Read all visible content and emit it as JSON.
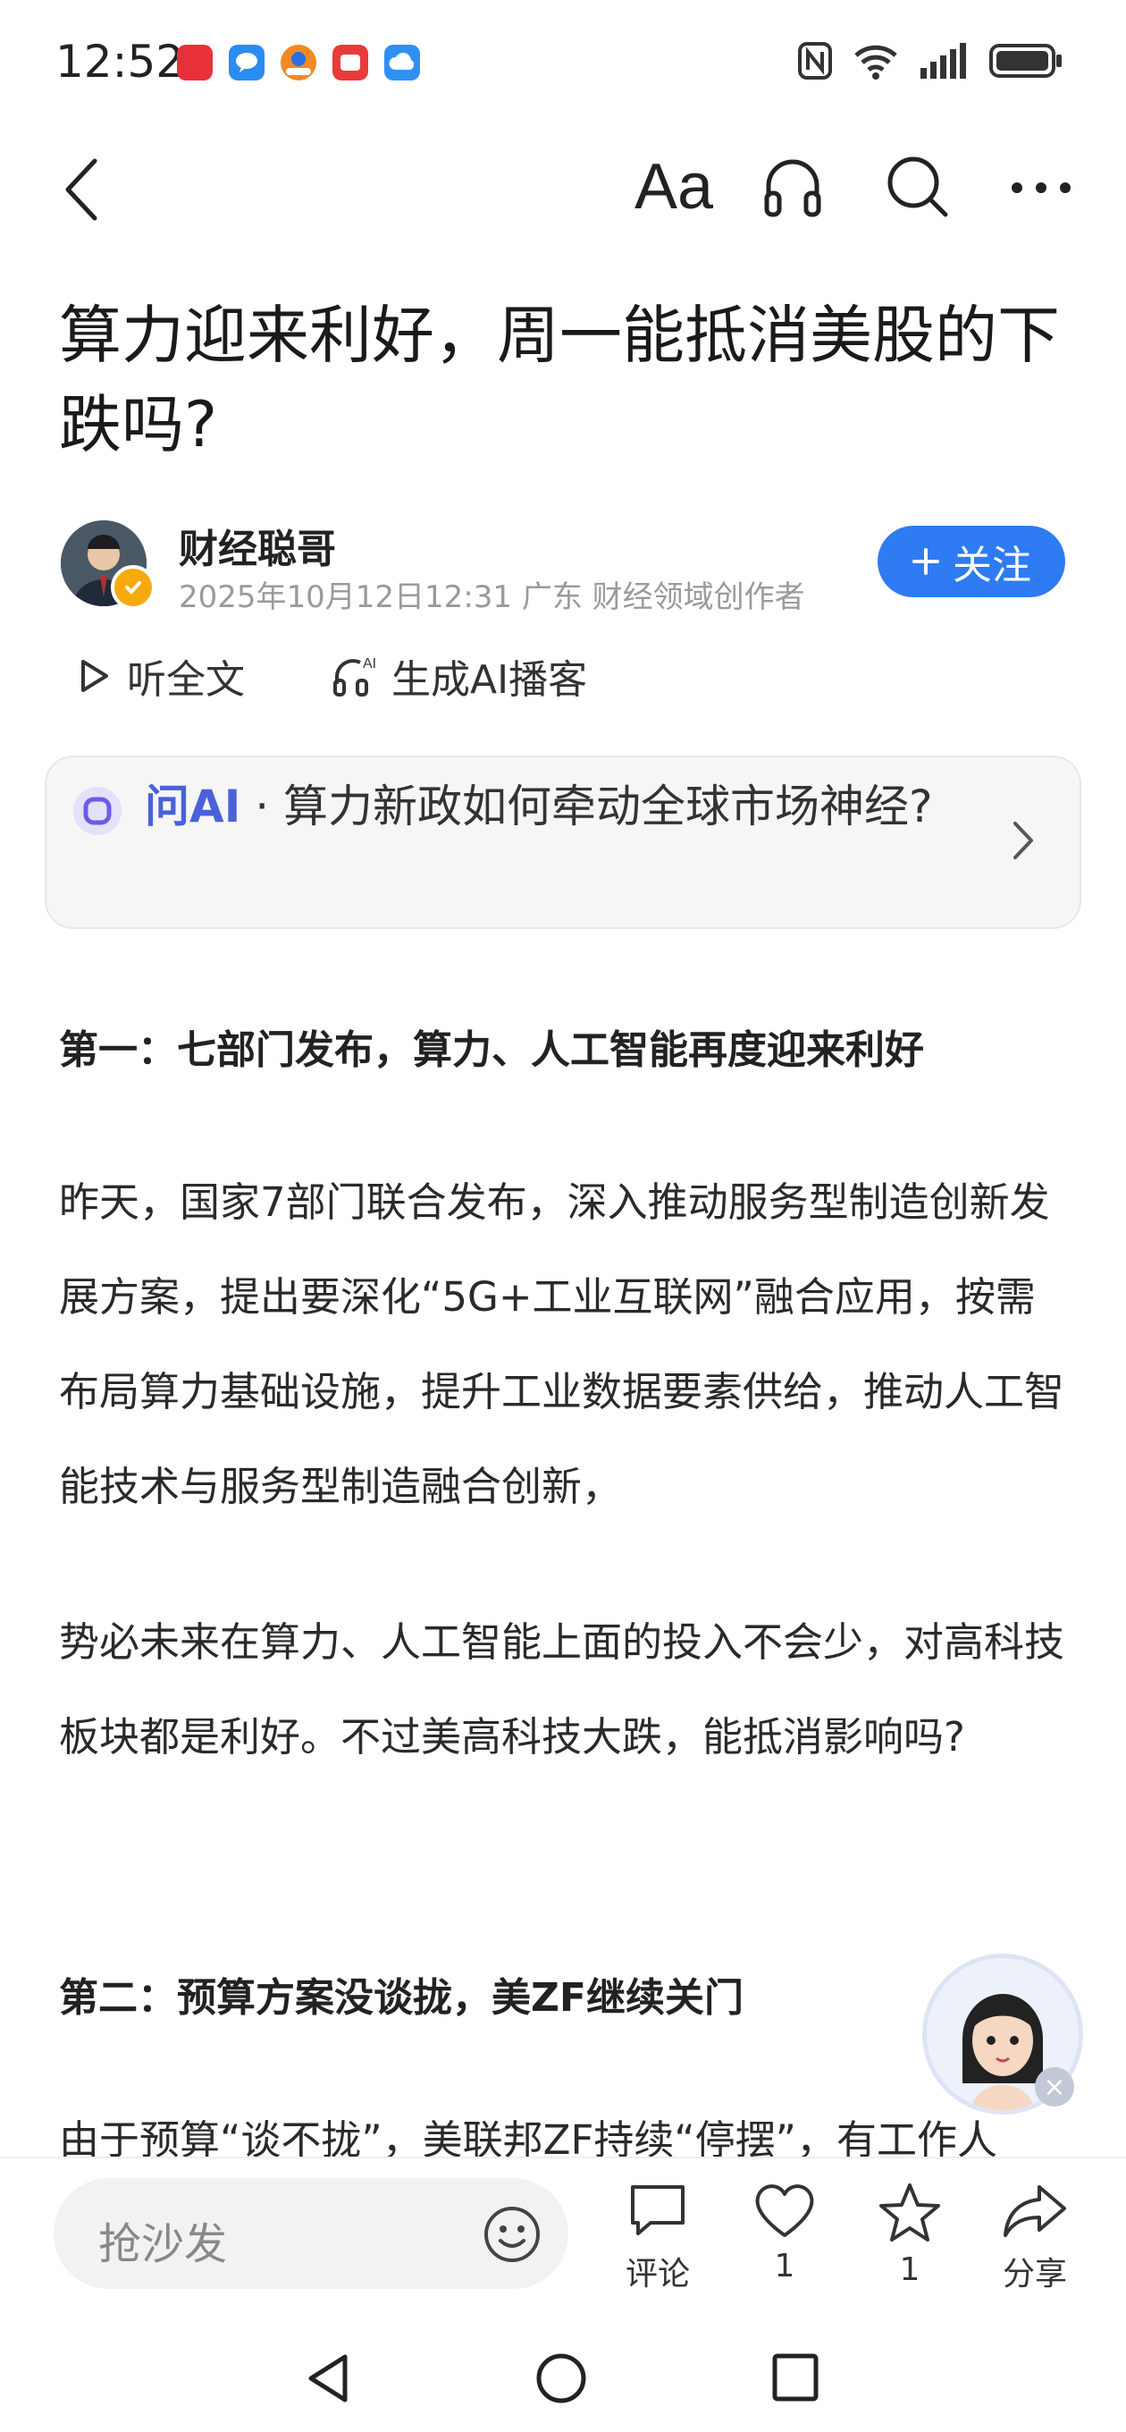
{
  "status_bar": {
    "time": "12:52",
    "app_icons": [
      {
        "name": "shopping-app-icon",
        "color": "#e8303a"
      },
      {
        "name": "chat-bubble-app-icon",
        "color": "#2a8cf0"
      },
      {
        "name": "mascot-app-icon",
        "color": "#f08a24"
      },
      {
        "name": "red-app-icon",
        "color": "#e83a3a"
      },
      {
        "name": "cloud-app-icon",
        "color": "#2f8ff5"
      }
    ],
    "right_icons": [
      "nfc-icon",
      "wifi-icon",
      "signal-icon",
      "battery-icon"
    ]
  },
  "nav": {
    "back_icon": "chevron-left-icon",
    "font_label": "Aa",
    "headphones_icon": "headphones-icon",
    "search_icon": "search-icon",
    "more_icon": "more-icon"
  },
  "article": {
    "title": "算力迎来利好，周一能抵消美股的下跌吗?",
    "author": {
      "name": "财经聪哥",
      "meta": "2025年10月12日12:31 广东 财经领域创作者"
    },
    "follow_label": "关注",
    "listen_label": "听全文",
    "gen_ai_label": "生成AI播客",
    "ask_ai": {
      "tag": "问AI",
      "separator": "·",
      "question": "算力新政如何牵动全球市场神经?"
    },
    "sections": [
      {
        "heading": "第一：七部门发布，算力、人工智能再度迎来利好"
      },
      {
        "paragraph": "昨天，国家7部门联合发布，深入推动服务型制造创新发展方案，提出要深化“5G+工业互联网”融合应用，按需布局算力基础设施，提升工业数据要素供给，推动人工智能技术与服务型制造融合创新，"
      },
      {
        "paragraph": "势必未来在算力、人工智能上面的投入不会少，对高科技板块都是利好。不过美高科技大跌，能抵消影响吗?"
      },
      {
        "heading": "第二：预算方案没谈拢，美ZF继续关门"
      },
      {
        "paragraph": "由于预算“谈不拢”，美联邦ZF持续“停摆”，有工作人"
      }
    ]
  },
  "bottom_bar": {
    "comment_placeholder": "抢沙发",
    "comment_label": "评论",
    "like_count": "1",
    "favorite_count": "1",
    "share_label": "分享"
  },
  "floating": {
    "close_symbol": "×"
  }
}
